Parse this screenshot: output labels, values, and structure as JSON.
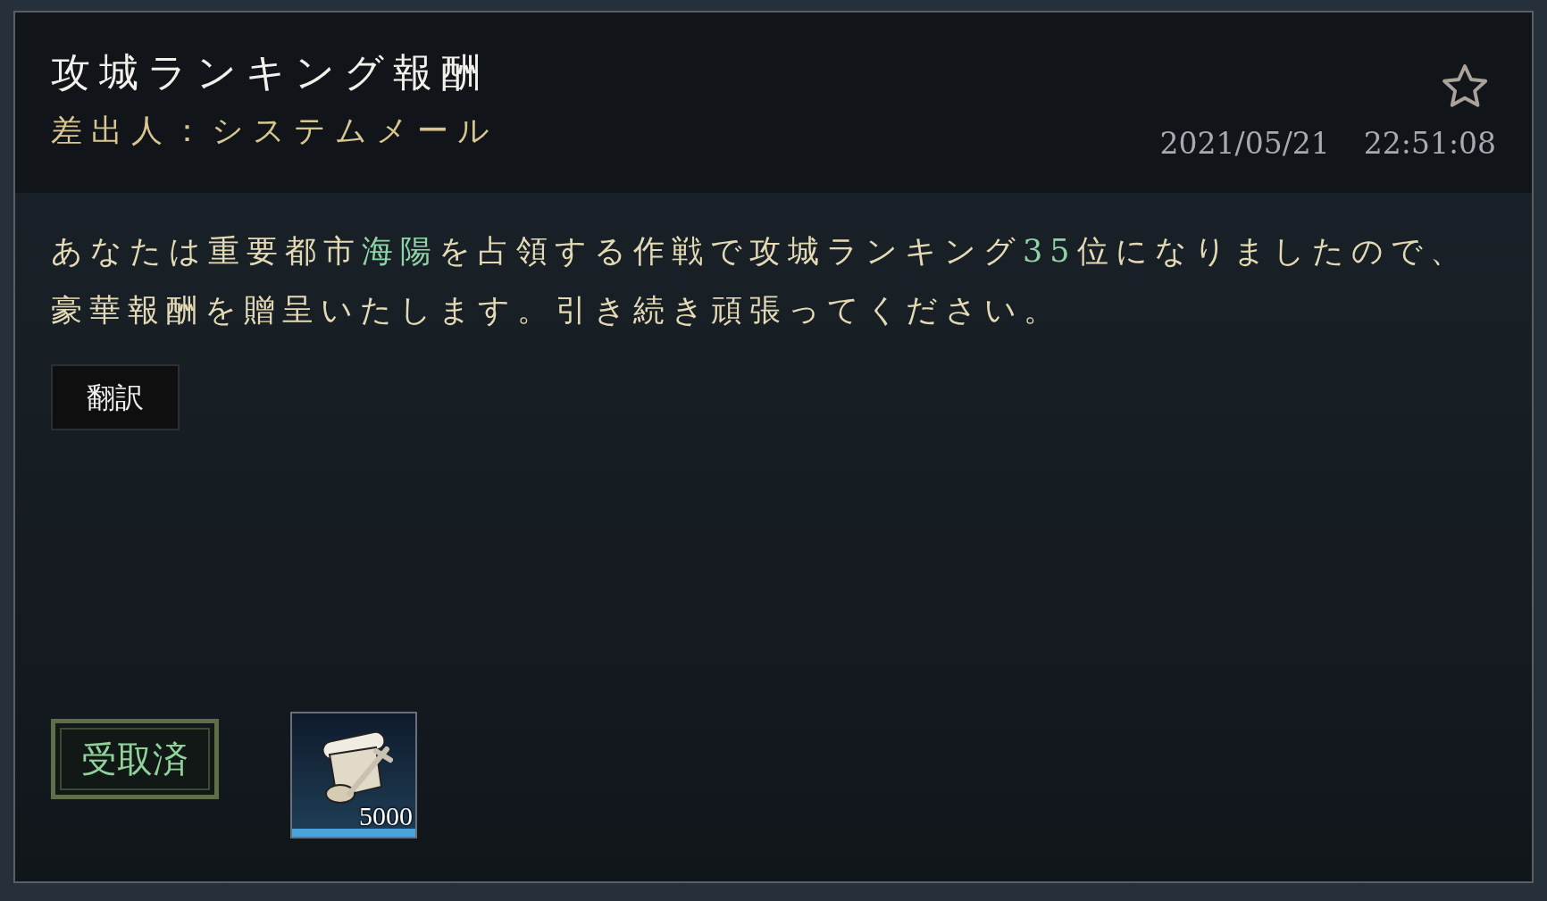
{
  "mail": {
    "title": "攻城ランキング報酬",
    "sender": "差出人：システムメール",
    "date": "2021/05/21",
    "time": "22:51:08",
    "starred": false
  },
  "message": {
    "segments": [
      {
        "text": "あなたは重要都市",
        "highlight": false
      },
      {
        "text": "海陽",
        "highlight": true
      },
      {
        "text": "を占領する作戦で攻城ランキング",
        "highlight": false
      },
      {
        "text": "35",
        "highlight": true
      },
      {
        "text": "位になりましたので、豪華報酬を贈呈いたします。引き続き頑張ってください。",
        "highlight": false
      }
    ]
  },
  "translate_button": "翻訳",
  "rewards": {
    "status": "受取済",
    "claimed": true,
    "items": [
      {
        "count": "5000"
      }
    ]
  }
}
